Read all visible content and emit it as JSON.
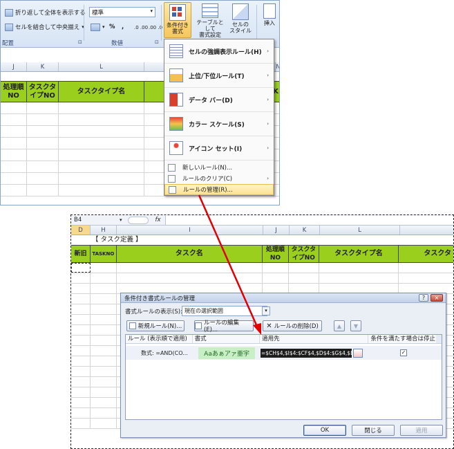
{
  "ribbon": {
    "wrap_text": "折り返して全体を表示する",
    "merge_center": "セルを結合して中央揃え",
    "merge_arrow": "▾",
    "number_format": "標準",
    "percent": "%",
    "comma": ",",
    "dec_inc": ".0 .00",
    "dec_dec": ".00 .0",
    "group_align_partial": "配置",
    "group_number": "数値",
    "cond_format_line1": "条件付き",
    "cond_format_line2": "書式",
    "table_format_line1": "テーブルとして",
    "table_format_line2": "書式設定",
    "cell_style_line1": "セルの",
    "cell_style_line2": "スタイル",
    "insert": "挿入"
  },
  "sheet1": {
    "cols": [
      "J",
      "K",
      "L",
      "N"
    ],
    "headers": [
      "処理順NO",
      "タスクタイプNO",
      "タスクタイプ名",
      "K"
    ]
  },
  "menu": {
    "items": [
      {
        "label": "セルの強調表示ルール(H)",
        "arrow": "›"
      },
      {
        "label": "上位/下位ルール(T)",
        "arrow": "›"
      },
      {
        "label": "データ バー(D)",
        "arrow": "›"
      },
      {
        "label": "カラー スケール(S)",
        "arrow": "›"
      },
      {
        "label": "アイコン セット(I)",
        "arrow": "›"
      }
    ],
    "small": [
      {
        "label": "新しいルール(N)..."
      },
      {
        "label": "ルールのクリア(C)",
        "arrow": "›"
      },
      {
        "label": "ルールの管理(R)..."
      }
    ]
  },
  "sheet2": {
    "cell_ref": "B4",
    "fx": "fx",
    "cols": [
      "D",
      "H",
      "I",
      "J",
      "K",
      "L"
    ],
    "section": "【 タスク定義 】",
    "headers": [
      "新旧",
      "TASKNO",
      "タスク名",
      "処理順NO",
      "タスクタイプNO",
      "タスクタイプ名",
      "タスクタ"
    ]
  },
  "dialog": {
    "title": "条件付き書式ルールの管理",
    "show_label": "書式ルールの表示(S):",
    "show_value": "現在の選択範囲",
    "new_rule": "新規ルール(N)...",
    "edit_rule": "ルールの編集(E)...",
    "delete_rule": "ルールの削除(D)",
    "col_rule": "ルール (表示順で適用)",
    "col_format": "書式",
    "col_applies": "適用先",
    "col_stop": "条件を満たす場合は停止",
    "rule_formula": "数式: =AND(CO...",
    "rule_preview": "Aaあぁアァ亜宇",
    "rule_range": "=$CH$4,$I$4:$CF$4,$D$4:$G$4,$B$4",
    "stop_checked": "✓",
    "ok": "OK",
    "close": "閉じる",
    "apply": "適用",
    "help": "?",
    "close_x": "×"
  },
  "colors": {
    "header_green": "#9bcf1d",
    "arrow_red": "#e00000",
    "accent": "#f7c65a"
  }
}
